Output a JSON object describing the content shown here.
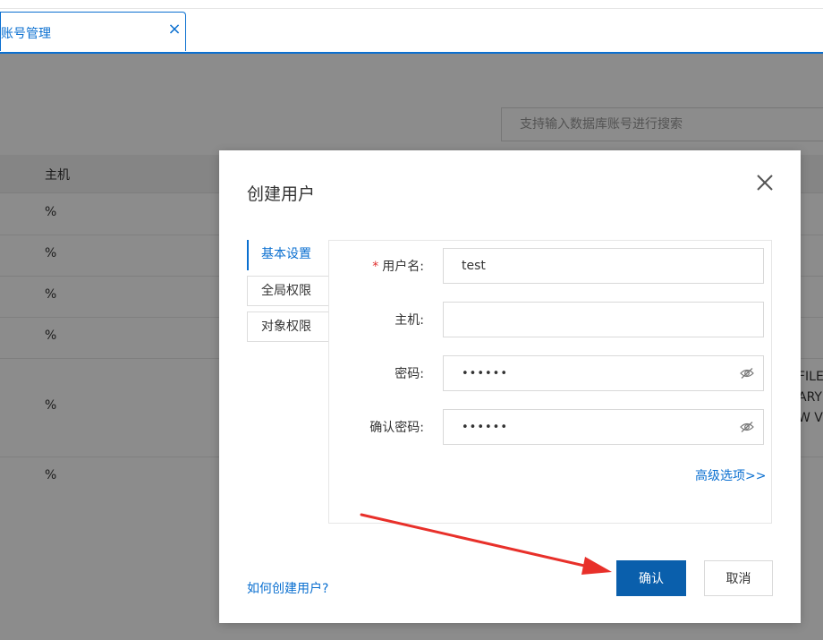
{
  "tabbar": {
    "active_tab": "账号管理"
  },
  "page": {
    "search_placeholder": "支持输入数据库账号进行搜索",
    "table": {
      "headers": [
        "主机"
      ],
      "host_values": [
        "%",
        "%",
        "%",
        "%",
        "%",
        "%"
      ],
      "privilege_fragments": [
        "FILE",
        "ARY",
        "W VI"
      ]
    }
  },
  "dialog": {
    "title": "创建用户",
    "tabs": [
      {
        "label": "基本设置",
        "active": true
      },
      {
        "label": "全局权限",
        "active": false
      },
      {
        "label": "对象权限",
        "active": false
      }
    ],
    "fields": {
      "username": {
        "label": "用户名:",
        "value": "test",
        "required": true
      },
      "host": {
        "label": "主机:",
        "value": ""
      },
      "password": {
        "label": "密码:",
        "value": "••••••"
      },
      "confirm_password": {
        "label": "确认密码:",
        "value": "••••••"
      }
    },
    "advanced_link": "高级选项>>",
    "help_link": "如何创建用户?",
    "confirm_button": "确认",
    "cancel_button": "取消"
  },
  "colors": {
    "primary": "#0a6fd0",
    "confirm_button": "#0a5fac",
    "annotation_arrow": "#e8302a",
    "required_mark": "#e0312f"
  },
  "icons": {
    "tab_close": "close-icon",
    "dialog_close": "close-icon",
    "password_toggle": "eye-off-icon"
  }
}
